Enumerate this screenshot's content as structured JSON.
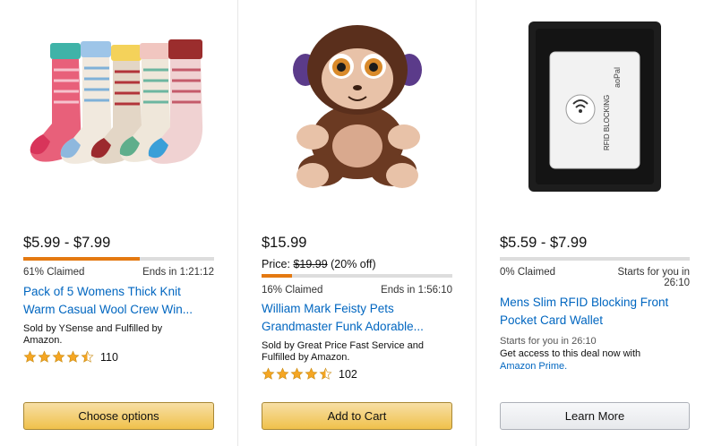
{
  "colors": {
    "link": "#0066c0",
    "progress": "#e47911",
    "button_yellow": "#f0c14b",
    "button_gray": "#e7e9ec",
    "star": "#f5a623"
  },
  "deals": [
    {
      "image_icon": "wool-socks-image",
      "price": "$5.99 - $7.99",
      "claimed_fraction": 0.61,
      "claimed_text": "61% Claimed",
      "timer_text": "Ends in 1:21:12",
      "title_line1": "Pack of 5 Womens Thick Knit",
      "title_line2": "Warm Casual Wool Crew Win...",
      "seller_line1": "Sold by YSense and Fulfilled by",
      "seller_line2": "Amazon.",
      "rating_stars": 4.5,
      "review_count": "110",
      "button_label": "Choose options"
    },
    {
      "image_icon": "monkey-plush-image",
      "price": "$15.99",
      "price_prefix": "Price: ",
      "list_price": "$19.99",
      "discount": " (20% off)",
      "claimed_fraction": 0.16,
      "claimed_text": "16% Claimed",
      "timer_text": "Ends in 1:56:10",
      "title_line1": "William Mark Feisty Pets",
      "title_line2": "Grandmaster Funk Adorable...",
      "seller_line1": "Sold by Great Price Fast Service and",
      "seller_line2": "Fulfilled by Amazon.",
      "rating_stars": 4.5,
      "review_count": "102",
      "button_label": "Add to Cart"
    },
    {
      "image_icon": "rfid-wallet-image",
      "price": "$5.59 - $7.99",
      "claimed_fraction": 0.0,
      "claimed_text": "0% Claimed",
      "timer_text_line1": "Starts for you in",
      "timer_text_line2": "26:10",
      "title_line1": "Mens Slim RFID Blocking Front",
      "title_line2": "Pocket Card Wallet",
      "starts_text": "Starts for you in 26:10",
      "access_text": "Get access to this deal now with",
      "prime_link": "Amazon Prime.",
      "wallet_brand": "aoPal",
      "wallet_tag": "RFID BLOCKING",
      "button_label": "Learn More"
    }
  ]
}
